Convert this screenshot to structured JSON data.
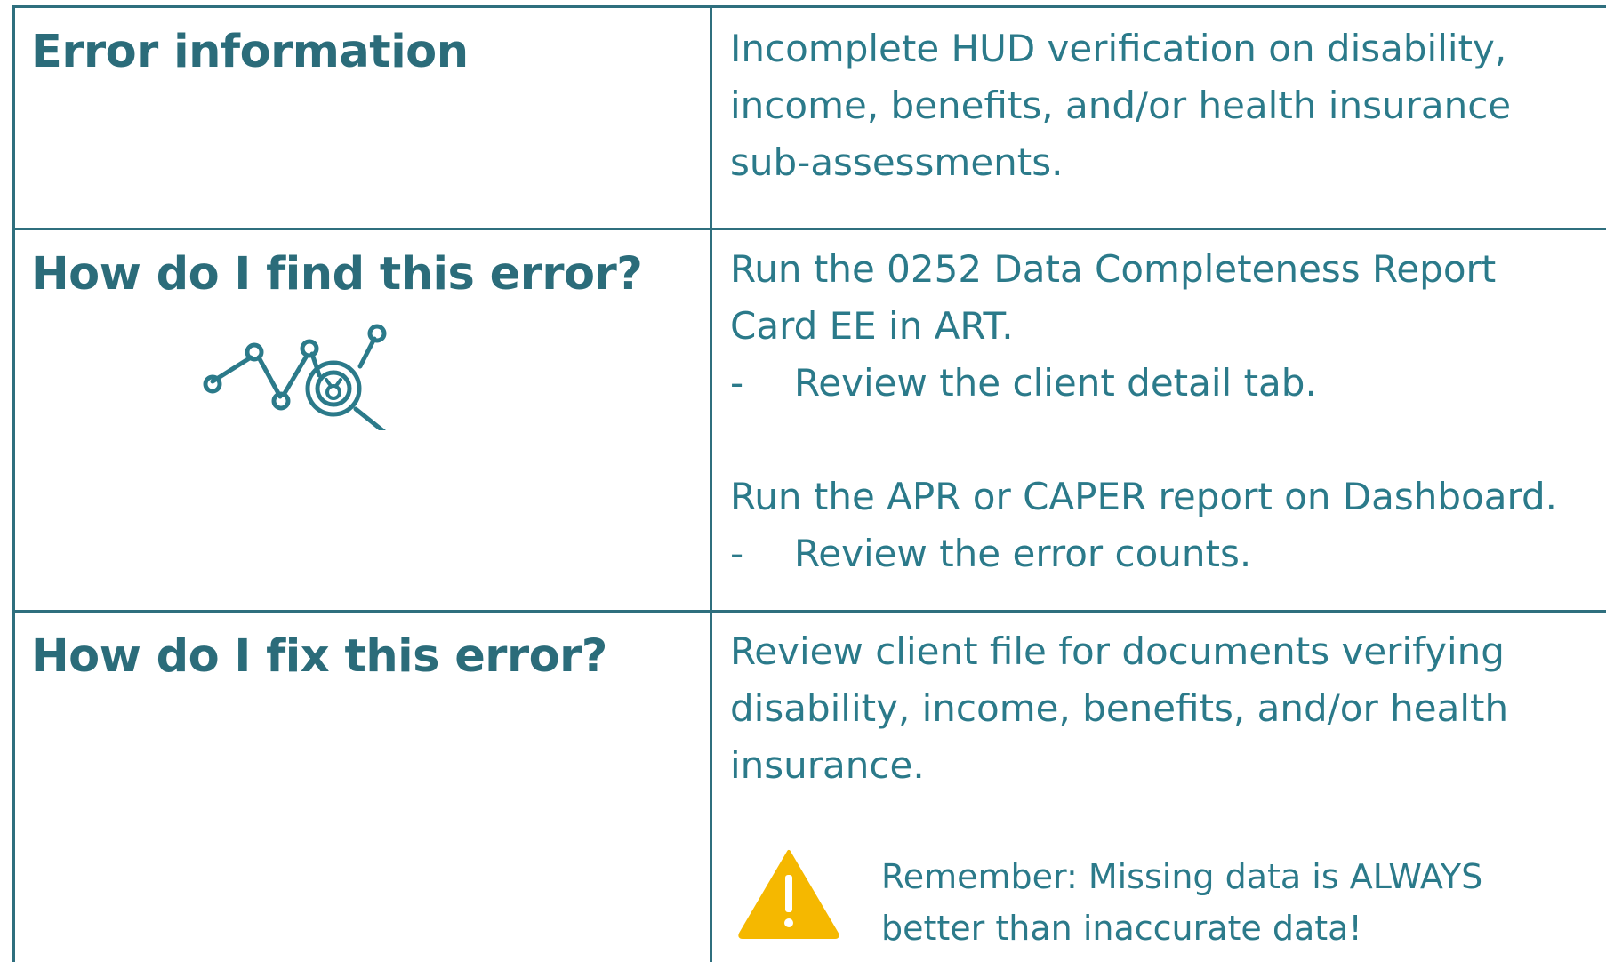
{
  "rows": [
    {
      "heading": "Error information",
      "lines": [
        "Incomplete HUD verification on disability,",
        "income, benefits, and/or health insurance",
        "sub-assessments."
      ]
    },
    {
      "heading": "How do I find this error?",
      "line1": "Run the 0252 Data Completeness Report",
      "line2": "Card EE in ART.",
      "bullet1_dash": "-",
      "bullet1": "Review the client detail tab.",
      "line3": "Run the APR or CAPER report on Dashboard.",
      "bullet2_dash": "-",
      "bullet2": "Review the error counts.",
      "icon": "chart-magnifier-icon"
    },
    {
      "heading": "How do I fix this error?",
      "lines": [
        "Review client file for documents verifying",
        "disability, income, benefits, and/or health",
        "insurance."
      ],
      "note_line1": "Remember: Missing data is ALWAYS",
      "note_line2": "better than inaccurate data!",
      "icon": "warning-icon"
    }
  ],
  "colors": {
    "heading": "#2b6c7a",
    "text": "#2b7a8a",
    "border": "#2f6f7e",
    "icon": "#2b7a8a",
    "warning": "#f5b800"
  }
}
